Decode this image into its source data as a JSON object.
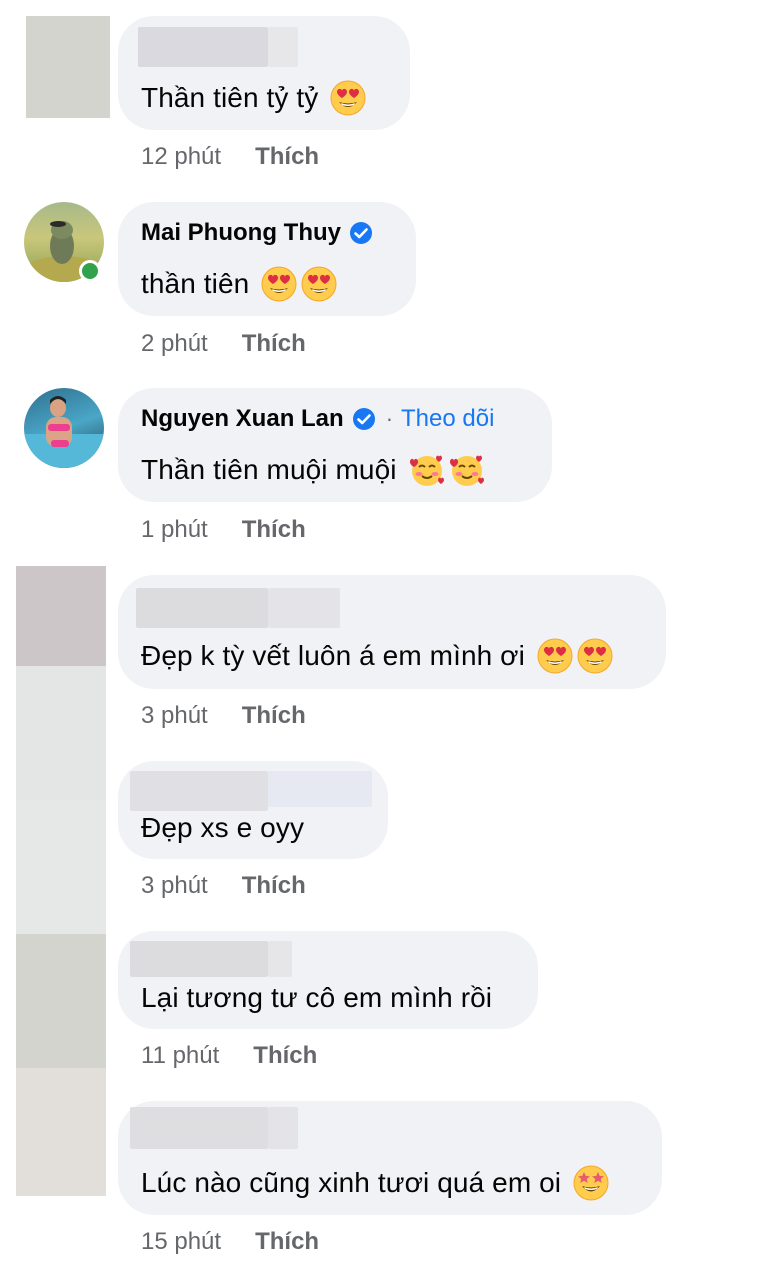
{
  "comments": [
    {
      "author": "",
      "text": "Thần tiên tỷ tỷ",
      "emojis": [
        "heart-eyes"
      ],
      "time": "12 phút",
      "like": "Thích"
    },
    {
      "author": "Mai Phuong Thuy",
      "verified": true,
      "online": true,
      "text": "thần tiên",
      "emojis": [
        "heart-eyes",
        "heart-eyes"
      ],
      "time": "2 phút",
      "like": "Thích"
    },
    {
      "author": "Nguyen Xuan Lan",
      "verified": true,
      "separator": "·",
      "follow": "Theo dõi",
      "text": "Thần tiên muội muội",
      "emojis": [
        "smiling-hearts",
        "smiling-hearts"
      ],
      "time": "1 phút",
      "like": "Thích"
    },
    {
      "author": "",
      "text": "Đẹp k tỳ vết luôn á em mình ơi",
      "emojis": [
        "heart-eyes",
        "heart-eyes"
      ],
      "time": "3 phút",
      "like": "Thích"
    },
    {
      "author": "",
      "text": "Đẹp xs e oyy",
      "emojis": [],
      "time": "3 phút",
      "like": "Thích"
    },
    {
      "author": "",
      "text": "Lại tương tư cô em mình rồi",
      "emojis": [],
      "time": "11 phút",
      "like": "Thích"
    },
    {
      "author": "",
      "text": "Lúc nào cũng xinh tươi quá em oi",
      "emojis": [
        "star-struck"
      ],
      "time": "15 phút",
      "like": "Thích"
    }
  ],
  "colors": {
    "bubble": "#f0f2f5",
    "meta": "#65676b",
    "link": "#1877f2",
    "online": "#31a24c",
    "verified": "#1877f2"
  }
}
